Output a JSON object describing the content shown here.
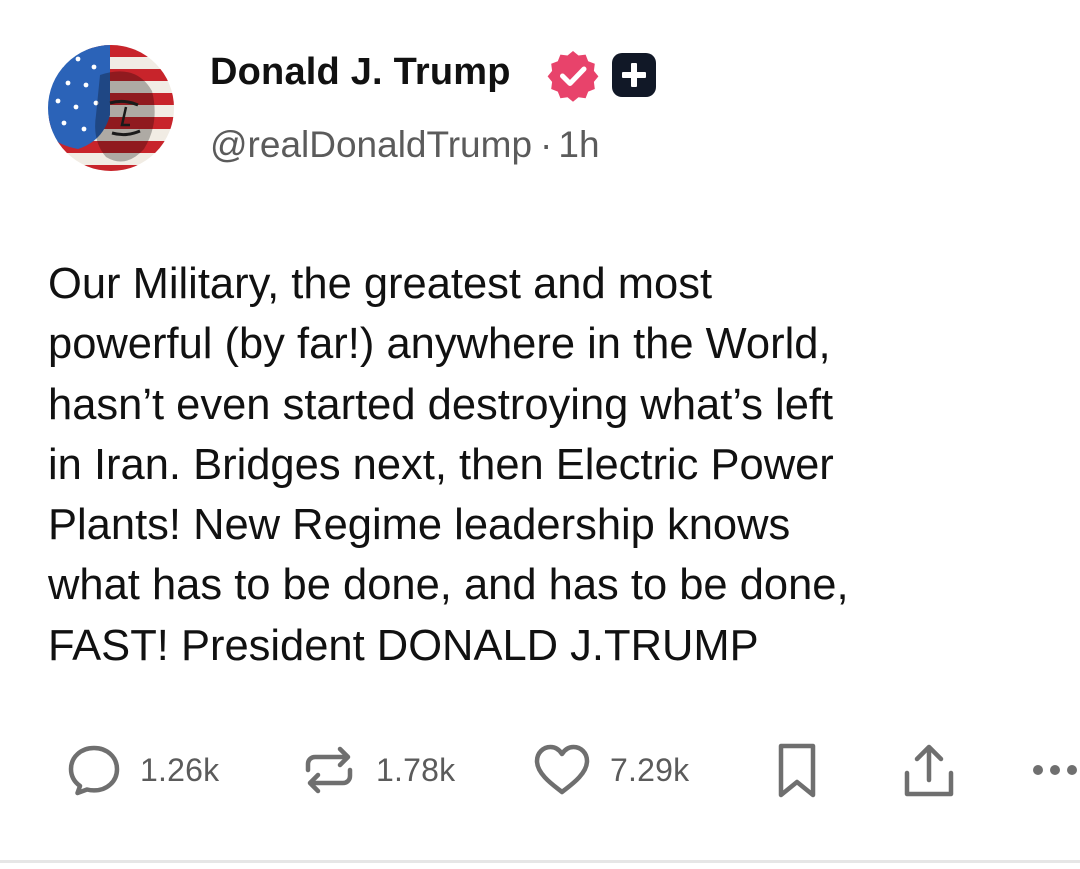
{
  "author": {
    "display_name": "Donald J. Trump",
    "handle": "@realDonaldTrump",
    "separator": "·",
    "time_ago": "1h",
    "verified_icon": "verified-badge-icon",
    "plus_badge_icon": "plus-badge-icon"
  },
  "post": {
    "lines": [
      "Our Military, the greatest and most",
      "powerful (by far!) anywhere in the World,",
      "hasn’t even started destroying what’s left",
      "in Iran. Bridges next, then Electric Power",
      "Plants! New Regime leadership knows",
      "what has to be done, and has to be done,",
      "FAST! President DONALD J.TRUMP"
    ]
  },
  "actions": {
    "replies": {
      "icon": "reply-icon",
      "count": "1.26k"
    },
    "reposts": {
      "icon": "repost-icon",
      "count": "1.78k"
    },
    "likes": {
      "icon": "heart-icon",
      "count": "7.29k"
    },
    "bookmark": {
      "icon": "bookmark-icon"
    },
    "share": {
      "icon": "share-icon"
    },
    "more": {
      "icon": "more-icon"
    }
  },
  "colors": {
    "text": "#111111",
    "muted": "#5b5b5b",
    "icon": "#6f6f6f",
    "verified": "#e8436b",
    "plus_badge": "#111827"
  }
}
